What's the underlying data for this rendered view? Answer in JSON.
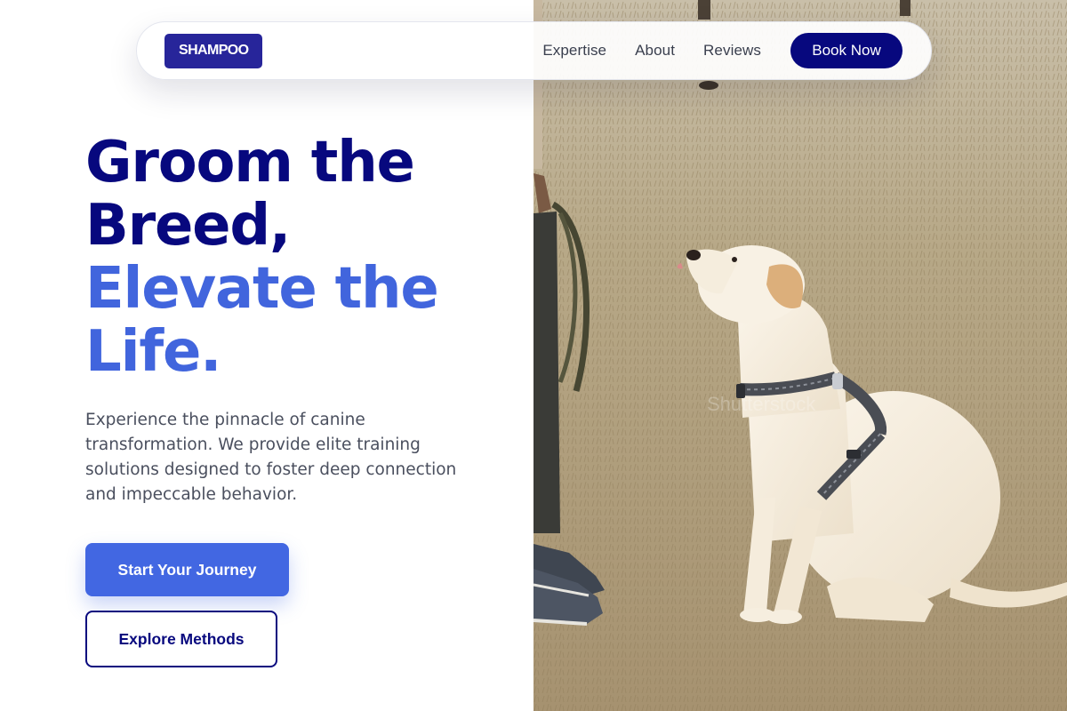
{
  "brand": {
    "logo_text": "SHAMPOO"
  },
  "nav": {
    "links": [
      "Expertise",
      "About",
      "Reviews"
    ],
    "cta_label": "Book Now"
  },
  "hero": {
    "title_lines": [
      "Groom the",
      "Breed,",
      "Elevate the",
      "Life."
    ],
    "description": "Experience the pinnacle of canine transformation. We provide elite training solutions designed to foster deep connection and impeccable behavior.",
    "primary_button": "Start Your Journey",
    "secondary_button": "Explore Methods"
  },
  "photo": {
    "subject": "dog-photo",
    "watermark_text": "Shutterstock"
  },
  "colors": {
    "navy": "#07087e",
    "accent_blue": "#4165dd",
    "logo_bg": "#27259a",
    "body_text": "#4a4f5e"
  }
}
